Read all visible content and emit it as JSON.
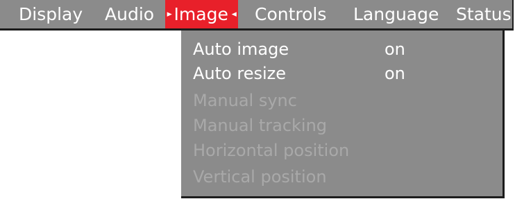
{
  "menubar": {
    "tabs": [
      {
        "label": "Display"
      },
      {
        "label": "Audio"
      },
      {
        "label": "Image",
        "left_marker": "▸",
        "right_marker": "◂"
      },
      {
        "label": "Controls"
      },
      {
        "label": "Language"
      },
      {
        "label": "Status"
      }
    ],
    "active_tab": "Image"
  },
  "image_menu": {
    "items": [
      {
        "label": "Auto image",
        "value": "on",
        "enabled": true
      },
      {
        "label": "Auto resize",
        "value": "on",
        "enabled": true
      },
      {
        "label": "Manual sync",
        "enabled": false
      },
      {
        "label": "Manual tracking",
        "enabled": false
      },
      {
        "label": "Horizontal position",
        "enabled": false
      },
      {
        "label": "Vertical position",
        "enabled": false
      }
    ]
  },
  "colors": {
    "menu_background": "#8b8b8b",
    "active_tab_background": "#e8202a",
    "text_enabled": "#ffffff",
    "text_disabled": "#a9a9a9",
    "border": "#1c1c1c"
  }
}
